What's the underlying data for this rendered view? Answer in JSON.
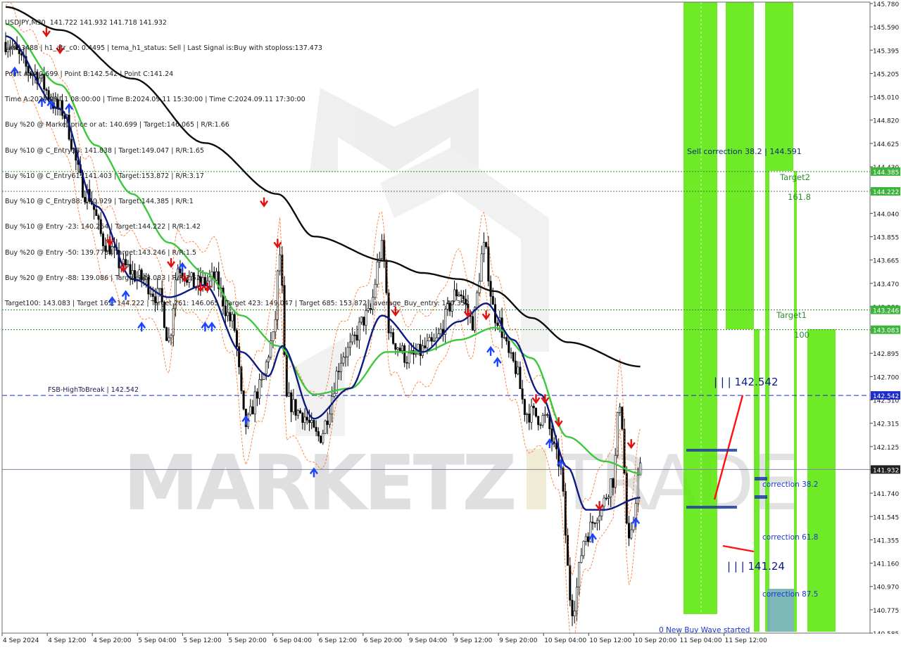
{
  "header": {
    "title": "USDJPY,M30  141.722 141.932 141.718 141.932",
    "info_lines": [
      "Line:3488 | h1_atr_c0: 0.4495 | tema_h1_status: Sell | Last Signal is:Buy with stoploss:137.473",
      "Point A:140.699 | Point B:142.542 | Point C:141.24",
      "Time A:2024.09.11 08:00:00 | Time B:2024.09.11 15:30:00 | Time C:2024.09.11 17:30:00",
      "Buy %20 @ Market price or at: 140.699 | Target:146.065 | R/R:1.66",
      "Buy %10 @ C_Entry38: 141.838 | Target:149.047 | R/R:1.65",
      "Buy %10 @ C_Entry61: 141.403 | Target:153.872 | R/R:3.17",
      "Buy %10 @ C_Entry88: 140.929 | Target:144.385 | R/R:1",
      "Buy %10 @ Entry -23: 140.264 | Target:144.222 | R/R:1.42",
      "Buy %20 @ Entry -50: 139.778 | Target:143.246 | R/R:1.5",
      "Buy %20 @ Entry -88: 139.086 | Target:143.083 | R/R:2.52",
      "Target100: 143.083 | Target 161: 144.222 | Target 261: 146.065 | Target 423: 149.047 | Target 685: 153.872 | average_Buy_entry: 140.352"
    ]
  },
  "watermark": {
    "text_left": "MARKETZ",
    "text_right": "TRADE"
  },
  "price_axis": {
    "ticks": [
      "145.780",
      "145.590",
      "145.395",
      "145.205",
      "145.010",
      "144.820",
      "144.625",
      "144.430",
      "144.235",
      "144.040",
      "143.855",
      "143.665",
      "143.470",
      "143.280",
      "143.090",
      "142.895",
      "142.700",
      "142.510",
      "142.315",
      "142.125",
      "141.930",
      "141.740",
      "141.545",
      "141.355",
      "141.160",
      "140.970",
      "140.775",
      "140.585"
    ],
    "current_price": "141.932",
    "badges": [
      {
        "value": "144.385",
        "price": 144.385,
        "color": "#3cb43c"
      },
      {
        "value": "144.222",
        "price": 144.222,
        "color": "#3cb43c"
      },
      {
        "value": "143.246",
        "price": 143.246,
        "color": "#3cb43c"
      },
      {
        "value": "143.083",
        "price": 143.083,
        "color": "#3cb43c"
      },
      {
        "value": "142.542",
        "price": 142.542,
        "color": "#1c2ccc"
      },
      {
        "value": "141.932",
        "price": 141.932,
        "color": "#202020"
      }
    ]
  },
  "time_axis": {
    "labels": [
      "4 Sep 2024",
      "4 Sep 12:00",
      "4 Sep 20:00",
      "5 Sep 04:00",
      "5 Sep 12:00",
      "5 Sep 20:00",
      "6 Sep 04:00",
      "6 Sep 12:00",
      "6 Sep 20:00",
      "9 Sep 04:00",
      "9 Sep 12:00",
      "9 Sep 20:00",
      "10 Sep 04:00",
      "10 Sep 12:00",
      "10 Sep 20:00",
      "11 Sep 04:00",
      "11 Sep 12:00"
    ]
  },
  "annotations": {
    "fsb": "FSB-HighToBreak | 142.542",
    "sell_correction": "Sell correction 38.2 | 144.591",
    "target2": "Target2",
    "t161": "161.8",
    "target1": "Target1",
    "t100": "100",
    "point_b": "| | | 142.542",
    "point_c": "| | | 141.24",
    "correction_382": "correction 38.2",
    "correction_618": "correction 61.8",
    "correction_875": "correction 87.5",
    "new_buy_wave": "0 New Buy Wave started"
  },
  "colors": {
    "background": "#ffffff",
    "ma_black": "#0d0d0d",
    "ma_green": "#3cc83c",
    "ma_navy": "#0c1a82",
    "zone_green": "#55e600",
    "hline_green": "#2e8b2e",
    "fsb_blue": "#1c2ccc",
    "dashed_orange": "#ff5a00",
    "arrow_red": "#e01010",
    "arrow_blue": "#1c44ff",
    "teal_box": "#6fb0b0"
  },
  "chart_data": {
    "type": "candlestick",
    "symbol": "USDJPY",
    "timeframe": "M30",
    "ohlc_last": {
      "open": 141.722,
      "high": 141.932,
      "low": 141.718,
      "close": 141.932
    },
    "ylim": [
      140.585,
      145.78
    ],
    "xlim": [
      "2024-09-04 00:00",
      "2024-09-11 20:00"
    ],
    "grid": false,
    "levels": [
      {
        "label": "FSB-HighToBreak",
        "price": 142.542
      },
      {
        "label": "Target2 161.8",
        "price": 144.222
      },
      {
        "label": "144.385",
        "price": 144.385
      },
      {
        "label": "Target1 100",
        "price": 143.083
      },
      {
        "label": "143.246",
        "price": 143.246
      },
      {
        "label": "Current price",
        "price": 141.932
      }
    ],
    "waves": {
      "point_a": {
        "price": 140.699,
        "time": "2024-09-11 08:00"
      },
      "point_b": {
        "price": 142.542,
        "time": "2024-09-11 15:30"
      },
      "point_c": {
        "price": 141.24,
        "time": "2024-09-11 17:30"
      }
    },
    "close_anchors": [
      [
        "2024-09-04 00:00",
        145.45
      ],
      [
        "2024-09-04 06:00",
        145.2
      ],
      [
        "2024-09-04 12:00",
        144.9
      ],
      [
        "2024-09-04 18:00",
        144.2
      ],
      [
        "2024-09-04 22:00",
        143.8
      ],
      [
        "2024-09-05 02:00",
        143.6
      ],
      [
        "2024-09-05 06:00",
        143.5
      ],
      [
        "2024-09-05 10:00",
        143.35
      ],
      [
        "2024-09-05 12:00",
        143.0
      ],
      [
        "2024-09-05 14:00",
        143.6
      ],
      [
        "2024-09-05 18:00",
        143.45
      ],
      [
        "2024-09-05 22:00",
        143.5
      ],
      [
        "2024-09-06 02:00",
        143.15
      ],
      [
        "2024-09-06 05:00",
        142.3
      ],
      [
        "2024-09-06 08:00",
        142.6
      ],
      [
        "2024-09-06 11:00",
        143.0
      ],
      [
        "2024-09-06 12:30",
        143.7
      ],
      [
        "2024-09-06 14:00",
        142.5
      ],
      [
        "2024-09-06 17:00",
        142.4
      ],
      [
        "2024-09-06 21:00",
        142.2
      ],
      [
        "2024-09-09 03:00",
        142.9
      ],
      [
        "2024-09-09 08:00",
        143.2
      ],
      [
        "2024-09-09 11:00",
        143.75
      ],
      [
        "2024-09-09 13:00",
        143.0
      ],
      [
        "2024-09-09 17:00",
        142.85
      ],
      [
        "2024-09-09 22:00",
        142.95
      ],
      [
        "2024-09-10 04:00",
        143.4
      ],
      [
        "2024-09-10 07:00",
        143.15
      ],
      [
        "2024-09-10 09:30",
        143.75
      ],
      [
        "2024-09-10 12:00",
        143.2
      ],
      [
        "2024-09-10 16:00",
        142.8
      ],
      [
        "2024-09-10 19:00",
        142.4
      ],
      [
        "2024-09-10 23:00",
        142.35
      ],
      [
        "2024-09-11 02:00",
        142.0
      ],
      [
        "2024-09-11 05:00",
        140.8
      ],
      [
        "2024-09-11 08:00",
        141.4
      ],
      [
        "2024-09-11 11:00",
        141.6
      ],
      [
        "2024-09-11 14:00",
        141.85
      ],
      [
        "2024-09-11 15:30",
        142.5
      ],
      [
        "2024-09-11 17:30",
        141.3
      ],
      [
        "2024-09-11 20:00",
        141.93
      ]
    ],
    "ma_long_anchors": [
      [
        "2024-09-04 00:00",
        145.74
      ],
      [
        "2024-09-04 12:00",
        145.55
      ],
      [
        "2024-09-05 04:00",
        145.15
      ],
      [
        "2024-09-05 20:00",
        144.62
      ],
      [
        "2024-09-06 12:00",
        144.2
      ],
      [
        "2024-09-06 20:00",
        143.85
      ],
      [
        "2024-09-09 12:00",
        143.65
      ],
      [
        "2024-09-09 20:00",
        143.55
      ],
      [
        "2024-09-10 04:00",
        143.5
      ],
      [
        "2024-09-10 12:00",
        143.4
      ],
      [
        "2024-09-10 20:00",
        143.18
      ],
      [
        "2024-09-11 04:00",
        142.98
      ],
      [
        "2024-09-11 20:00",
        142.78
      ]
    ],
    "ma_mid_anchors": [
      [
        "2024-09-04 00:00",
        145.6
      ],
      [
        "2024-09-04 12:00",
        145.1
      ],
      [
        "2024-09-04 20:00",
        144.6
      ],
      [
        "2024-09-05 04:00",
        144.2
      ],
      [
        "2024-09-05 12:00",
        143.8
      ],
      [
        "2024-09-05 20:00",
        143.55
      ],
      [
        "2024-09-06 04:00",
        143.2
      ],
      [
        "2024-09-06 12:00",
        142.95
      ],
      [
        "2024-09-06 20:00",
        142.55
      ],
      [
        "2024-09-09 04:00",
        142.6
      ],
      [
        "2024-09-09 12:00",
        142.9
      ],
      [
        "2024-09-09 20:00",
        142.9
      ],
      [
        "2024-09-10 04:00",
        143.0
      ],
      [
        "2024-09-10 12:00",
        143.1
      ],
      [
        "2024-09-10 20:00",
        142.85
      ],
      [
        "2024-09-11 04:00",
        142.2
      ],
      [
        "2024-09-11 12:00",
        142.0
      ],
      [
        "2024-09-11 20:00",
        141.9
      ]
    ],
    "ma_short_anchors": [
      [
        "2024-09-04 00:00",
        145.5
      ],
      [
        "2024-09-04 12:00",
        144.9
      ],
      [
        "2024-09-04 20:00",
        144.1
      ],
      [
        "2024-09-05 04:00",
        143.5
      ],
      [
        "2024-09-05 12:00",
        143.35
      ],
      [
        "2024-09-05 20:00",
        143.45
      ],
      [
        "2024-09-06 04:00",
        142.9
      ],
      [
        "2024-09-06 10:00",
        142.7
      ],
      [
        "2024-09-06 13:00",
        142.95
      ],
      [
        "2024-09-06 20:00",
        142.35
      ],
      [
        "2024-09-09 04:00",
        142.6
      ],
      [
        "2024-09-09 11:00",
        143.2
      ],
      [
        "2024-09-09 20:00",
        142.9
      ],
      [
        "2024-09-10 04:00",
        143.15
      ],
      [
        "2024-09-10 10:00",
        143.3
      ],
      [
        "2024-09-10 16:00",
        143.0
      ],
      [
        "2024-09-10 22:00",
        142.55
      ],
      [
        "2024-09-11 04:00",
        141.95
      ],
      [
        "2024-09-11 08:00",
        141.6
      ],
      [
        "2024-09-11 12:00",
        141.6
      ],
      [
        "2024-09-11 20:00",
        141.7
      ]
    ]
  }
}
